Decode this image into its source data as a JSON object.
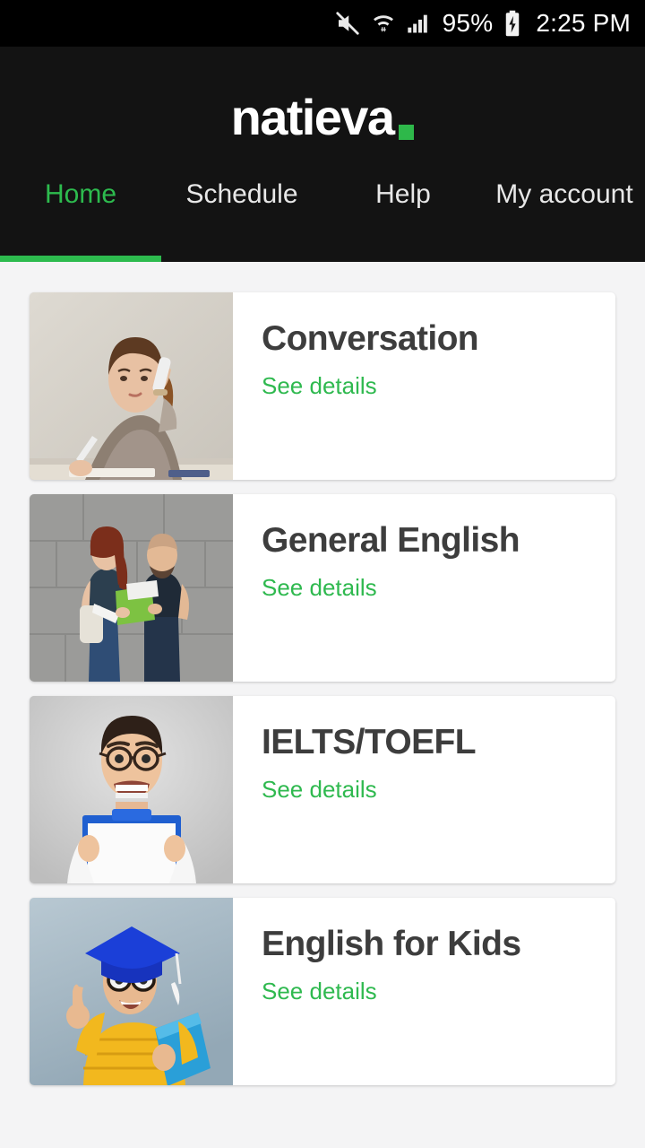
{
  "status_bar": {
    "icons": [
      "mute-icon",
      "wifi-icon",
      "cellular-signal-icon",
      "battery-charging-icon"
    ],
    "battery_percent": "95%",
    "time": "2:25 PM"
  },
  "header": {
    "logo_text": "natieva",
    "logo_dot": "",
    "background_color": "#131313",
    "accent_color": "#2eb84a"
  },
  "tabs": [
    {
      "label": "Home",
      "active": true
    },
    {
      "label": "Schedule",
      "active": false
    },
    {
      "label": "Help",
      "active": false
    },
    {
      "label": "My account",
      "active": false
    }
  ],
  "courses": [
    {
      "title": "Conversation",
      "link_label": "See details",
      "thumb": "woman-on-phone-writing-photo"
    },
    {
      "title": "General English",
      "link_label": "See details",
      "thumb": "couple-reading-book-wall-photo"
    },
    {
      "title": "IELTS/TOEFL",
      "link_label": "See details",
      "thumb": "man-holding-clipboard-photo"
    },
    {
      "title": "English for Kids",
      "link_label": "See details",
      "thumb": "boy-graduation-cap-photo"
    }
  ],
  "colors": {
    "accent_green": "#2dbb4e",
    "link_green": "#2fb94f",
    "title_gray": "#3d3d3d",
    "page_background": "#f4f4f5",
    "card_background": "#ffffff"
  }
}
